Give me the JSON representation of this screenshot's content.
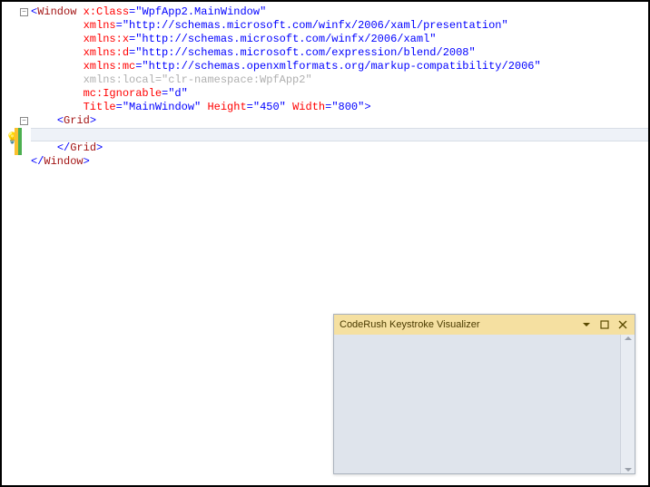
{
  "code": {
    "l1": {
      "elem": "Window",
      "attr": "x:Class",
      "val": "\"WpfApp2.MainWindow\""
    },
    "l2": {
      "attr": "xmlns",
      "val": "\"http://schemas.microsoft.com/winfx/2006/xaml/presentation\""
    },
    "l3": {
      "attr": "xmlns:x",
      "val": "\"http://schemas.microsoft.com/winfx/2006/xaml\""
    },
    "l4": {
      "attr": "xmlns:d",
      "val": "\"http://schemas.microsoft.com/expression/blend/2008\""
    },
    "l5": {
      "attr": "xmlns:mc",
      "val": "\"http://schemas.openxmlformats.org/markup-compatibility/2006\""
    },
    "l6": {
      "attr": "xmlns:local",
      "val": "\"clr-namespace:WpfApp2\""
    },
    "l7": {
      "attr": "mc:Ignorable",
      "val": "\"d\""
    },
    "l8": {
      "attr1": "Title",
      "val1": "\"MainWindow\"",
      "attr2": "Height",
      "val2": "\"450\"",
      "attr3": "Width",
      "val3": "\"800\""
    },
    "l9": {
      "elem": "Grid"
    },
    "l10": "",
    "l11": {
      "elem": "Grid"
    },
    "l12": {
      "elem": "Window"
    }
  },
  "toolwindow": {
    "title": "CodeRush Keystroke Visualizer"
  }
}
